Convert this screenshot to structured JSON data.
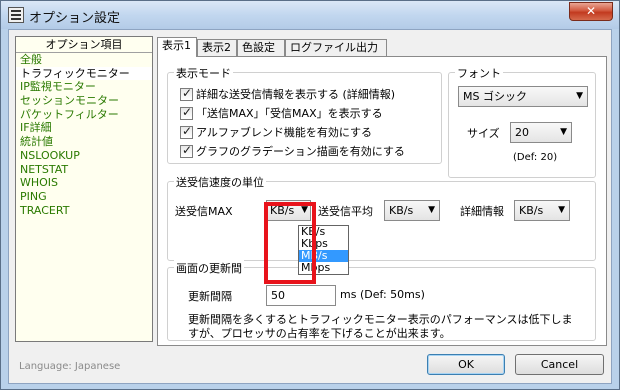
{
  "window": {
    "title": "オプション設定",
    "close_label": "✕"
  },
  "left_panel": {
    "header": "オプション項目",
    "items": [
      {
        "label": "全般"
      },
      {
        "label": "トラフィックモニター",
        "selected": true
      },
      {
        "label": "IP監視モニター"
      },
      {
        "label": "セッションモニター"
      },
      {
        "label": "パケットフィルター"
      },
      {
        "label": "IF詳細"
      },
      {
        "label": "統計値"
      },
      {
        "label": "NSLOOKUP"
      },
      {
        "label": "NETSTAT"
      },
      {
        "label": "WHOIS"
      },
      {
        "label": "PING"
      },
      {
        "label": "TRACERT"
      }
    ]
  },
  "language": "Language: Japanese",
  "tabs": [
    {
      "label": "表示1",
      "active": true
    },
    {
      "label": "表示2"
    },
    {
      "label": "色設定"
    },
    {
      "label": "ログファイル出力"
    }
  ],
  "display_mode": {
    "title": "表示モード",
    "options": [
      {
        "label": "詳細な送受信情報を表示する (詳細情報)",
        "checked": true
      },
      {
        "label": "「送信MAX」「受信MAX」を表示する",
        "checked": true
      },
      {
        "label": "アルファブレンド機能を有効にする",
        "checked": true
      },
      {
        "label": "グラフのグラデーション描画を有効にする",
        "checked": true
      }
    ]
  },
  "font": {
    "title": "フォント",
    "face_value": "MS ゴシック",
    "size_label": "サイズ",
    "size_value": "20",
    "default_note": "(Def: 20)"
  },
  "speed_unit": {
    "title": "送受信速度の単位",
    "max_label": "送受信MAX",
    "max_value": "KB/s",
    "avg_label": "送受信平均",
    "avg_value": "KB/s",
    "detail_label": "詳細情報",
    "detail_value": "KB/s",
    "dropdown_options": [
      "KB/s",
      "Kbps",
      "MB/s",
      "Mbps"
    ],
    "dropdown_highlighted": "MB/s"
  },
  "refresh": {
    "title": "画面の更新間",
    "interval_label": "更新間隔",
    "interval_value": "50",
    "interval_note": "ms (Def: 50ms)",
    "description_line1": "更新間隔を多くするとトラフィックモニター表示のパフォーマンスは低下しま",
    "description_line2": "すが、プロセッサの占有率を下げることが出来ます。"
  },
  "buttons": {
    "ok": "OK",
    "cancel": "Cancel"
  },
  "colors": {
    "title_bar": "#c2d7ef",
    "close_button": "#c23a1f",
    "tree_text": "#2a7a00",
    "list_highlight": "#3399ff",
    "annotation_box": "#e8131b"
  }
}
